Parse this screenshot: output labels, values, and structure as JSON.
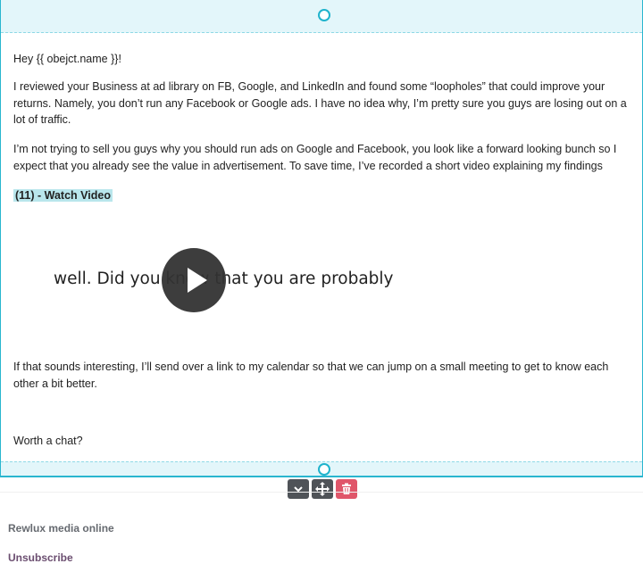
{
  "email": {
    "greeting": "Hey {{ obejct.name }}!",
    "paragraph_1": "I reviewed your Business at ad library on FB, Google, and LinkedIn and found some “loopholes” that could improve your returns. Namely, you don’t run any Facebook or Google ads. I have no idea why, I’m pretty sure you guys are losing out on a lot of traffic.",
    "paragraph_2": "I’m not trying to sell you guys why you should run ads on Google and Facebook, you look like a forward looking bunch so I expect that you already see the value in advertisement. To save time, I’ve recorded a short video explaining my findings",
    "watch_video_label": "(11) - Watch Video",
    "video_caption": "well. Did you know that you are probably",
    "paragraph_3": "If that sounds interesting, I’ll send over a link to my calendar so that we can jump on a small meeting to get to know each other a bit better.",
    "closing": "Worth a chat?"
  },
  "block_toolbar": {
    "icons": [
      "chevron-down-icon",
      "move-icon",
      "trash-icon"
    ],
    "colors": {
      "neutral": "#4f5358",
      "danger": "#e0566a"
    }
  },
  "footer": {
    "company": "Rewlux media online",
    "unsubscribe": "Unsubscribe"
  },
  "theme": {
    "selection_border": "#29b6cf",
    "padding_fill": "#e3f6fa",
    "highlight": "#b9e6ec"
  }
}
